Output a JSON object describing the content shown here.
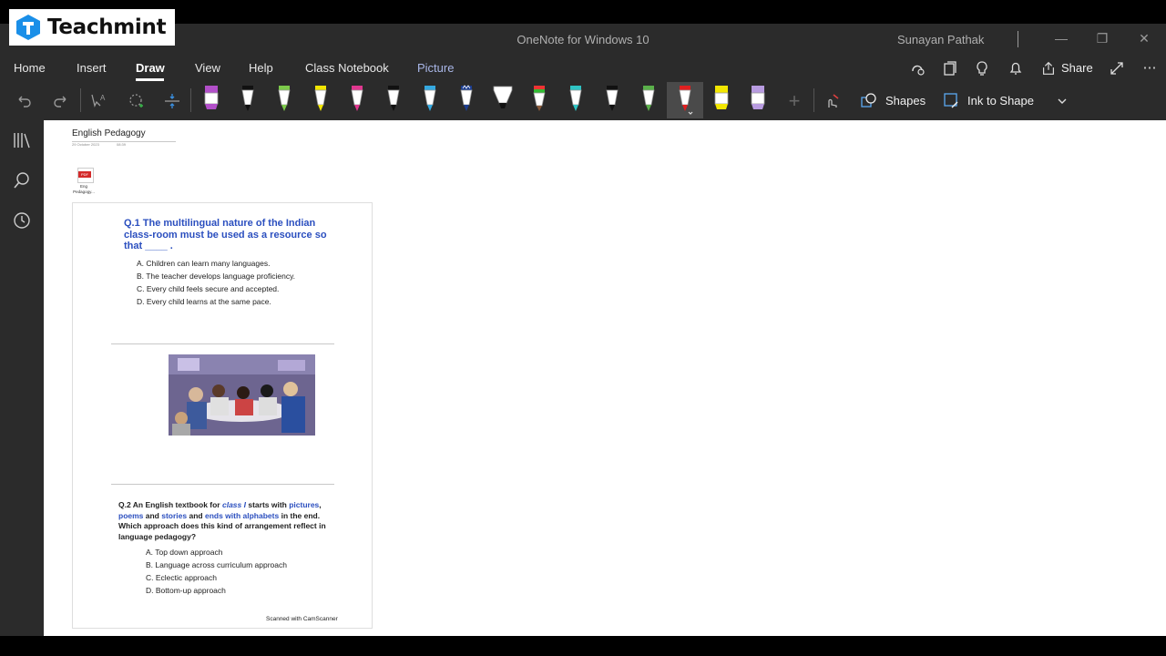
{
  "brand": {
    "name": "Teachmint",
    "color": "#1a8fe8"
  },
  "window": {
    "title": "OneNote for Windows 10",
    "user": "Sunayan Pathak"
  },
  "ribbon": {
    "tabs": [
      "Home",
      "Insert",
      "Draw",
      "View",
      "Help",
      "Class Notebook",
      "Picture"
    ],
    "active_tab": "Draw",
    "share_label": "Share"
  },
  "toolbar": {
    "shapes_label": "Shapes",
    "ink_to_shape_label": "Ink to Shape",
    "pens": [
      {
        "color": "#b24fc9",
        "kind": "highlighter"
      },
      {
        "color": "#111111",
        "kind": "pen"
      },
      {
        "color": "#7cc94a",
        "kind": "pen"
      },
      {
        "color": "#f2e600",
        "kind": "pen"
      },
      {
        "color": "#e0378f",
        "kind": "pen"
      },
      {
        "color": "#111111",
        "kind": "pen"
      },
      {
        "color": "#35a9e0",
        "kind": "pen"
      },
      {
        "color": "#1c3d8f",
        "kind": "pencil"
      },
      {
        "color": "#111111",
        "kind": "marker"
      },
      {
        "color": "#8a5a3a",
        "kind": "rainbow"
      },
      {
        "color": "#2fc4c4",
        "kind": "pen"
      },
      {
        "color": "#111111",
        "kind": "pen"
      },
      {
        "color": "#5ab04a",
        "kind": "pen"
      },
      {
        "color": "#e02020",
        "kind": "pen-selected"
      },
      {
        "color": "#f2e600",
        "kind": "highlighter"
      },
      {
        "color": "#b89be0",
        "kind": "highlighter"
      }
    ]
  },
  "page": {
    "title": "English Pedagogy",
    "date": "29 October 2023",
    "time": "08:39",
    "attachment": {
      "badge": "PDF",
      "name": "Eng Pedagogy..."
    }
  },
  "document": {
    "q1": {
      "text": "Q.1 The multilingual nature of the Indian class-room must be used as a resource so that ____ .",
      "options": [
        "A. Children can learn many languages.",
        "B. The teacher develops language proficiency.",
        "C. Every child feels secure and accepted.",
        "D. Every child learns at the same pace."
      ]
    },
    "q2": {
      "p1": "Q.2 An English textbook for ",
      "class": "class I",
      "p2": " starts with ",
      "pictures": "pictures",
      "comma": ",",
      "poems": "poems",
      "and1": " and ",
      "stories": "stories",
      "and2": " and ",
      "ends": "ends with alphabets",
      "p3": " in the end. Which approach does this kind of arrangement reflect in language pedagogy?",
      "options": [
        "A. Top down approach",
        "B. Language across curriculum approach",
        "C. Eclectic approach",
        "D. Bottom-up approach"
      ]
    },
    "footer": "Scanned with CamScanner"
  }
}
